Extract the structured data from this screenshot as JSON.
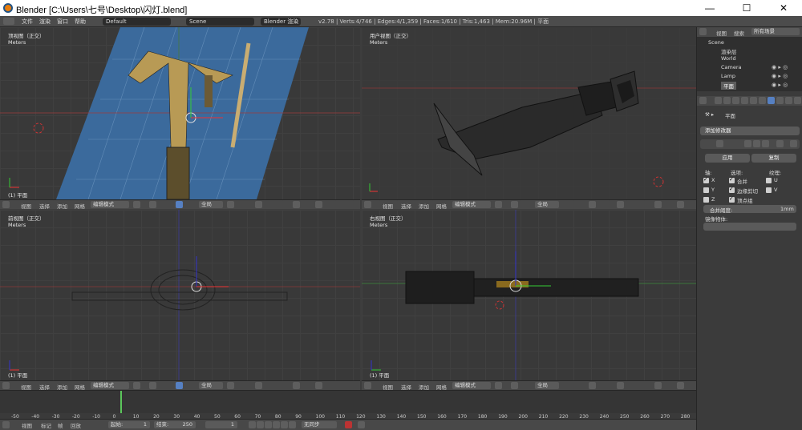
{
  "window": {
    "title": "Blender [C:\\Users\\七号\\Desktop\\闪灯.blend]",
    "minimize": "—",
    "maximize": "☐",
    "close": "✕"
  },
  "menubar": {
    "items": [
      "文件",
      "渲染",
      "窗口",
      "帮助"
    ],
    "layout": "Default",
    "scene": "Scene",
    "engine": "Blender 渲染",
    "stats": "v2.78 | Verts:4/746 | Edges:4/1,359 | Faces:1/610 | Tris:1,463 | Mem:20.96M | 平面"
  },
  "viewports": [
    {
      "label": "顶视图（正交）",
      "units": "Meters",
      "object": "(1) 平面"
    },
    {
      "label": "用户视图（正交）",
      "units": "Meters",
      "object": ""
    },
    {
      "label": "前视图（正交）",
      "units": "Meters",
      "object": "(1) 平面"
    },
    {
      "label": "右视图（正交）",
      "units": "Meters",
      "object": "(1) 平面"
    }
  ],
  "viewport_header": {
    "menus": [
      "视图",
      "选择",
      "添加",
      "网格"
    ],
    "mode": "编辑模式",
    "pivot": "全局"
  },
  "outliner": {
    "menus": [
      "视图",
      "搜索",
      "所有场景"
    ],
    "items": [
      "Scene",
      "渲染层",
      "World",
      "Camera",
      "Lamp",
      "平面"
    ]
  },
  "properties": {
    "object_name": "平面",
    "add_modifier": "添加修改器",
    "apply": "应用",
    "copy": "复制",
    "axis_label": "轴:",
    "options_label": "选项:",
    "texture_label": "纹理:",
    "axes": [
      "X",
      "Y",
      "Z"
    ],
    "options": [
      "合并",
      "边缘剪切",
      "顶点组"
    ],
    "uv": [
      "U",
      "V"
    ],
    "merge_label": "合并阈度:",
    "merge_value": "1mm",
    "mirror_obj_label": "镜像物体:"
  },
  "timeline": {
    "ticks": [
      "-50",
      "-40",
      "-30",
      "-20",
      "-10",
      "0",
      "10",
      "20",
      "30",
      "40",
      "50",
      "60",
      "70",
      "80",
      "90",
      "100",
      "110",
      "120",
      "130",
      "140",
      "150",
      "160",
      "170",
      "180",
      "190",
      "200",
      "210",
      "220",
      "230",
      "240",
      "250",
      "260",
      "270",
      "280"
    ],
    "menus": [
      "视图",
      "标记",
      "帧",
      "回放"
    ],
    "start_label": "起始:",
    "start": "1",
    "end_label": "结束:",
    "end": "250",
    "current": "1",
    "sync": "无同步"
  }
}
